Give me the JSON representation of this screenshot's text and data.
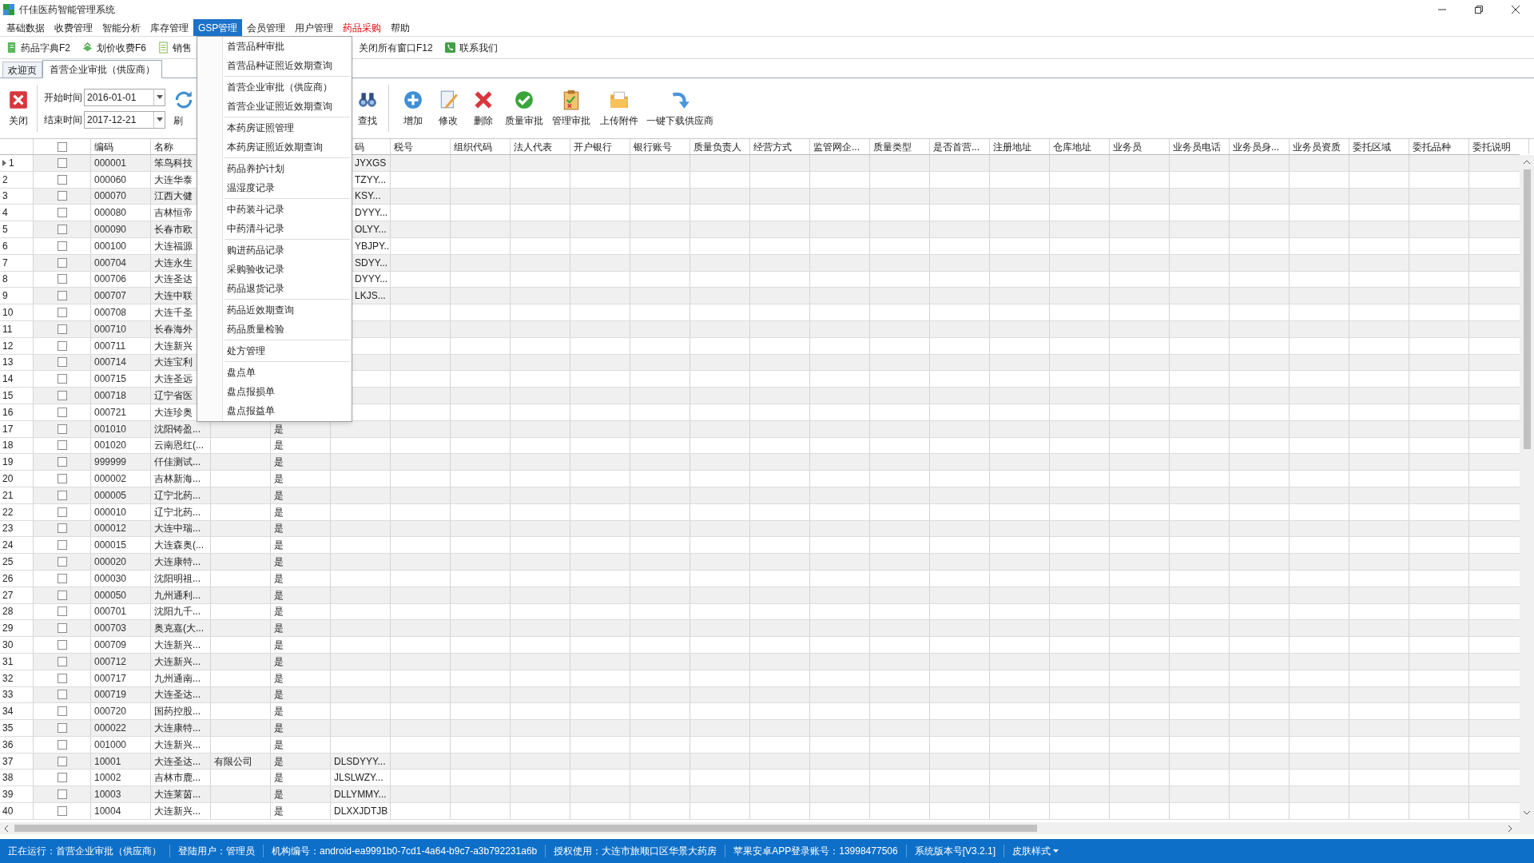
{
  "window": {
    "title": "仟佳医药智能管理系统"
  },
  "menu_bar": [
    {
      "label": "基础数据",
      "selected": false,
      "emphasis": false
    },
    {
      "label": "收费管理",
      "selected": false,
      "emphasis": false
    },
    {
      "label": "智能分析",
      "selected": false,
      "emphasis": false
    },
    {
      "label": "库存管理",
      "selected": false,
      "emphasis": false
    },
    {
      "label": "GSP管理",
      "selected": true,
      "emphasis": false
    },
    {
      "label": "会员管理",
      "selected": false,
      "emphasis": false
    },
    {
      "label": "用户管理",
      "selected": false,
      "emphasis": false
    },
    {
      "label": "药品采购",
      "selected": false,
      "emphasis": true
    },
    {
      "label": "帮助",
      "selected": false,
      "emphasis": false
    }
  ],
  "gsp_menu": {
    "groups": [
      [
        "首营品种审批",
        "首营品种证照近效期查询"
      ],
      [
        "首营企业审批（供应商）",
        "首营企业证照近效期查询"
      ],
      [
        "本药房证照管理",
        "本药房证照近效期查询"
      ],
      [
        "药品养护计划",
        "温湿度记录"
      ],
      [
        "中药装斗记录",
        "中药清斗记录"
      ],
      [
        "购进药品记录",
        "采购验收记录",
        "药品退货记录"
      ],
      [
        "药品近效期查询",
        "药品质量检验"
      ],
      [
        "处方管理"
      ],
      [
        "盘点单",
        "盘点报损单",
        "盘点报益单"
      ]
    ]
  },
  "quick_bar_left": [
    {
      "label": "药品字典F2",
      "kind": "book"
    },
    {
      "label": "划价收费F6",
      "kind": "cash"
    },
    {
      "label": "销售",
      "kind": "list"
    }
  ],
  "quick_bar_right": [
    {
      "label": "关闭所有窗口F12",
      "kind": "none"
    },
    {
      "label": "联系我们",
      "kind": "phone"
    }
  ],
  "tabs": [
    {
      "label": "欢迎页",
      "selected": false
    },
    {
      "label": "首营企业审批（供应商）",
      "selected": true
    }
  ],
  "toolbar": {
    "close": "关闭",
    "start_label": "开始时间",
    "start_value": "2016-01-01",
    "end_label": "结束时间",
    "end_value": "2017-12-21",
    "buttons_left": [
      {
        "label": "刷",
        "kind": "refresh"
      }
    ],
    "buttons_right": [
      {
        "label": "查找",
        "kind": "find"
      },
      {
        "label": "增加",
        "kind": "add"
      },
      {
        "label": "修改",
        "kind": "edit"
      },
      {
        "label": "删除",
        "kind": "delete"
      },
      {
        "label": "质量审批",
        "kind": "check"
      },
      {
        "label": "管理审批",
        "kind": "clipboard"
      },
      {
        "label": "上传附件",
        "kind": "folder"
      },
      {
        "label": "一键下载供应商",
        "kind": "download"
      }
    ]
  },
  "table": {
    "select_all": {
      "checked": false
    },
    "columns": [
      {
        "label": "编码"
      },
      {
        "label": "名称"
      },
      {},
      {},
      {
        "label": "码"
      },
      {
        "label": "税号"
      },
      {
        "label": "组织代码"
      },
      {
        "label": "法人代表"
      },
      {
        "label": "开户银行"
      },
      {
        "label": "银行账号"
      },
      {
        "label": "质量负责人"
      },
      {
        "label": "经营方式"
      },
      {
        "label": "监管网企..."
      },
      {
        "label": "质量类型"
      },
      {
        "label": "是否首营..."
      },
      {
        "label": "注册地址"
      },
      {
        "label": "仓库地址"
      },
      {
        "label": "业务员"
      },
      {
        "label": "业务员电话"
      },
      {
        "label": "业务员身..."
      },
      {
        "label": "业务员资质"
      },
      {
        "label": "委托区域"
      },
      {
        "label": "委托品种"
      },
      {
        "label": "委托说明"
      }
    ],
    "rows": [
      {
        "number": "1",
        "checked": false,
        "current": true,
        "code": "000001",
        "name": "笨鸟科技",
        "column_6": "JYXGS"
      },
      {
        "number": "2",
        "checked": false,
        "current": false,
        "code": "000060",
        "name": "大连华泰",
        "column_6": "TZYY..."
      },
      {
        "number": "3",
        "checked": false,
        "current": false,
        "code": "000070",
        "name": "江西大健",
        "column_6": "KSY..."
      },
      {
        "number": "4",
        "checked": false,
        "current": false,
        "code": "000080",
        "name": "吉林恒帝",
        "column_6": "DYYY..."
      },
      {
        "number": "5",
        "checked": false,
        "current": false,
        "code": "000090",
        "name": "长春市欧",
        "column_6": "OLYY..."
      },
      {
        "number": "6",
        "checked": false,
        "current": false,
        "code": "000100",
        "name": "大连福源",
        "column_6": "YBJPY..."
      },
      {
        "number": "7",
        "checked": false,
        "current": false,
        "code": "000704",
        "name": "大连永生",
        "column_6": "SDYY..."
      },
      {
        "number": "8",
        "checked": false,
        "current": false,
        "code": "000706",
        "name": "大连圣达",
        "column_6": "DYYY..."
      },
      {
        "number": "9",
        "checked": false,
        "current": false,
        "code": "000707",
        "name": "大连中联",
        "column_6": "LKJS..."
      },
      {
        "number": "10",
        "checked": false,
        "current": false,
        "code": "000708",
        "name": "大连千圣"
      },
      {
        "number": "11",
        "checked": false,
        "current": false,
        "code": "000710",
        "name": "长春海外"
      },
      {
        "number": "12",
        "checked": false,
        "current": false,
        "code": "000711",
        "name": "大连新兴"
      },
      {
        "number": "13",
        "checked": false,
        "current": false,
        "code": "000714",
        "name": "大连宝利"
      },
      {
        "number": "14",
        "checked": false,
        "current": false,
        "code": "000715",
        "name": "大连圣远"
      },
      {
        "number": "15",
        "checked": false,
        "current": false,
        "code": "000718",
        "name": "辽宁省医"
      },
      {
        "number": "16",
        "checked": false,
        "current": false,
        "code": "000721",
        "name": "大连珍奥"
      },
      {
        "number": "17",
        "checked": false,
        "current": false,
        "code": "001010",
        "name": "沈阳铸盈...",
        "column_5": "是"
      },
      {
        "number": "18",
        "checked": false,
        "current": false,
        "code": "001020",
        "name": "云南恩红(...",
        "column_5": "是"
      },
      {
        "number": "19",
        "checked": false,
        "current": false,
        "code": "999999",
        "name": "仟佳测试...",
        "column_5": "是"
      },
      {
        "number": "20",
        "checked": false,
        "current": false,
        "code": "000002",
        "name": "吉林新海...",
        "column_5": "是"
      },
      {
        "number": "21",
        "checked": false,
        "current": false,
        "code": "000005",
        "name": "辽宁北药...",
        "column_5": "是"
      },
      {
        "number": "22",
        "checked": false,
        "current": false,
        "code": "000010",
        "name": "辽宁北药...",
        "column_5": "是"
      },
      {
        "number": "23",
        "checked": false,
        "current": false,
        "code": "000012",
        "name": "大连中瑞...",
        "column_5": "是"
      },
      {
        "number": "24",
        "checked": false,
        "current": false,
        "code": "000015",
        "name": "大连森奥(...",
        "column_5": "是"
      },
      {
        "number": "25",
        "checked": false,
        "current": false,
        "code": "000020",
        "name": "大连康特...",
        "column_5": "是"
      },
      {
        "number": "26",
        "checked": false,
        "current": false,
        "code": "000030",
        "name": "沈阳明祖...",
        "column_5": "是"
      },
      {
        "number": "27",
        "checked": false,
        "current": false,
        "code": "000050",
        "name": "九州通利...",
        "column_5": "是"
      },
      {
        "number": "28",
        "checked": false,
        "current": false,
        "code": "000701",
        "name": "沈阳九千...",
        "column_5": "是"
      },
      {
        "number": "29",
        "checked": false,
        "current": false,
        "code": "000703",
        "name": "奥克嘉(大...",
        "column_5": "是"
      },
      {
        "number": "30",
        "checked": false,
        "current": false,
        "code": "000709",
        "name": "大连新兴...",
        "column_5": "是"
      },
      {
        "number": "31",
        "checked": false,
        "current": false,
        "code": "000712",
        "name": "大连新兴...",
        "column_5": "是"
      },
      {
        "number": "32",
        "checked": false,
        "current": false,
        "code": "000717",
        "name": "九州通南...",
        "column_5": "是"
      },
      {
        "number": "33",
        "checked": false,
        "current": false,
        "code": "000719",
        "name": "大连圣达...",
        "column_5": "是"
      },
      {
        "number": "34",
        "checked": false,
        "current": false,
        "code": "000720",
        "name": "国药控股...",
        "column_5": "是"
      },
      {
        "number": "35",
        "checked": false,
        "current": false,
        "code": "000022",
        "name": "大连康特...",
        "column_5": "是"
      },
      {
        "number": "36",
        "checked": false,
        "current": false,
        "code": "001000",
        "name": "大连新兴...",
        "column_5": "是"
      },
      {
        "number": "37",
        "checked": false,
        "current": false,
        "code": "10001",
        "name": "大连圣达...",
        "column_4": "有限公司",
        "column_5": "是",
        "column_6": "DLSDYYY..."
      },
      {
        "number": "38",
        "checked": false,
        "current": false,
        "code": "10002",
        "name": "吉林市鹿...",
        "column_5": "是",
        "column_6": "JLSLWZY..."
      },
      {
        "number": "39",
        "checked": false,
        "current": false,
        "code": "10003",
        "name": "大连莱茵...",
        "column_5": "是",
        "column_6": "DLLYMMY..."
      },
      {
        "number": "40",
        "checked": false,
        "current": false,
        "code": "10004",
        "name": "大连新兴...",
        "column_5": "是",
        "column_6": "DLXXJDTJB"
      }
    ]
  },
  "status_bar": {
    "items": [
      "正在运行：首营企业审批（供应商）",
      "登陆用户：管理员",
      "机构编号：android-ea9991b0-7cd1-4a64-b9c7-a3b792231a6b",
      "授权使用：大连市旅顺口区华景大药房",
      "苹果安卓APP登录账号：13998477506",
      "系统版本号[V3.2.1]"
    ],
    "skin": "皮肤样式"
  }
}
